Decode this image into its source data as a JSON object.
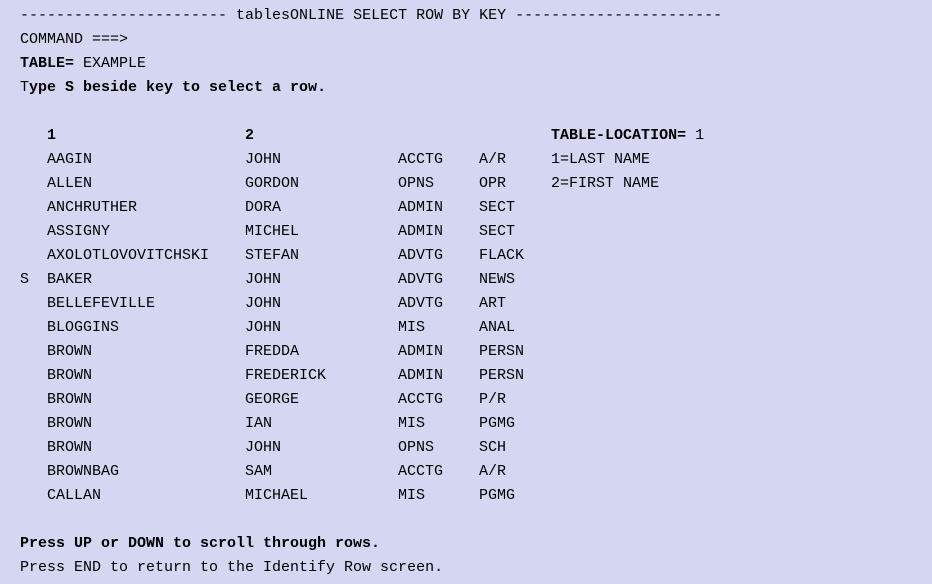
{
  "title": {
    "leading_dashes": "-----------------------",
    "text": " tablesONLINE SELECT ROW BY KEY ",
    "trailing_dashes": "-----------------------"
  },
  "command": {
    "label": "COMMAND ===>",
    "value": ""
  },
  "table": {
    "label": "TABLE=",
    "value": " EXAMPLE"
  },
  "instruction_prefix": "T",
  "instruction_bold": "ype S beside key to select a row.",
  "columns": {
    "c1": "1",
    "c2": "2",
    "table_location_label": "TABLE-LOCATION=",
    "table_location_value": " 1"
  },
  "legend": {
    "l1": "1=LAST NAME",
    "l2": "2=FIRST NAME"
  },
  "rows": [
    {
      "sel": " ",
      "c1": "AAGIN",
      "c2": "JOHN",
      "c3": "ACCTG",
      "c4": "A/R",
      "legend": "1=LAST NAME"
    },
    {
      "sel": " ",
      "c1": "ALLEN",
      "c2": "GORDON",
      "c3": "OPNS",
      "c4": "OPR",
      "legend": "2=FIRST NAME"
    },
    {
      "sel": " ",
      "c1": "ANCHRUTHER",
      "c2": "DORA",
      "c3": "ADMIN",
      "c4": "SECT",
      "legend": ""
    },
    {
      "sel": " ",
      "c1": "ASSIGNY",
      "c2": "MICHEL",
      "c3": "ADMIN",
      "c4": "SECT",
      "legend": ""
    },
    {
      "sel": " ",
      "c1": "AXOLOTLOVOVITCHSKI",
      "c2": "STEFAN",
      "c3": "ADVTG",
      "c4": "FLACK",
      "legend": ""
    },
    {
      "sel": "S",
      "c1": "BAKER",
      "c2": "JOHN",
      "c3": "ADVTG",
      "c4": "NEWS",
      "legend": ""
    },
    {
      "sel": " ",
      "c1": "BELLEFEVILLE",
      "c2": "JOHN",
      "c3": "ADVTG",
      "c4": "ART",
      "legend": ""
    },
    {
      "sel": " ",
      "c1": "BLOGGINS",
      "c2": "JOHN",
      "c3": "MIS",
      "c4": "ANAL",
      "legend": ""
    },
    {
      "sel": " ",
      "c1": "BROWN",
      "c2": "FREDDA",
      "c3": "ADMIN",
      "c4": "PERSN",
      "legend": ""
    },
    {
      "sel": " ",
      "c1": "BROWN",
      "c2": "FREDERICK",
      "c3": "ADMIN",
      "c4": "PERSN",
      "legend": ""
    },
    {
      "sel": " ",
      "c1": "BROWN",
      "c2": "GEORGE",
      "c3": "ACCTG",
      "c4": "P/R",
      "legend": ""
    },
    {
      "sel": " ",
      "c1": "BROWN",
      "c2": "IAN",
      "c3": "MIS",
      "c4": "PGMG",
      "legend": ""
    },
    {
      "sel": " ",
      "c1": "BROWN",
      "c2": "JOHN",
      "c3": "OPNS",
      "c4": "SCH",
      "legend": ""
    },
    {
      "sel": " ",
      "c1": "BROWNBAG",
      "c2": "SAM",
      "c3": "ACCTG",
      "c4": "A/R",
      "legend": ""
    },
    {
      "sel": " ",
      "c1": "CALLAN",
      "c2": "MICHAEL",
      "c3": "MIS",
      "c4": "PGMG",
      "legend": ""
    }
  ],
  "footer1": "Press UP or DOWN to scroll through rows.",
  "footer2": "Press END to return to the Identify Row screen."
}
